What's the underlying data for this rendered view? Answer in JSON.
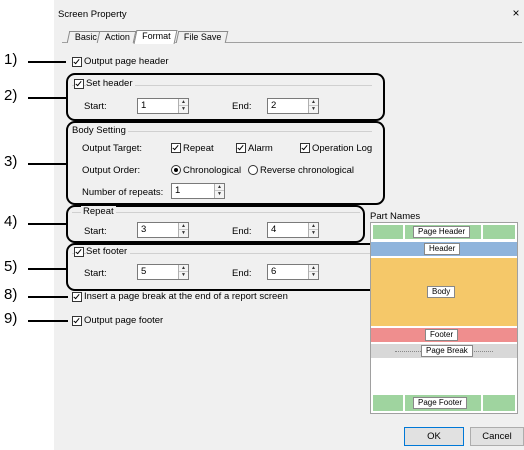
{
  "window": {
    "title": "Screen Property",
    "close_glyph": "×"
  },
  "tabs": [
    {
      "label": "Basic"
    },
    {
      "label": "Action"
    },
    {
      "label": "Format"
    },
    {
      "label": "File Save"
    }
  ],
  "callout_numbers": [
    "1)",
    "2)",
    "3)",
    "4)",
    "5)",
    "8)",
    "9)"
  ],
  "output_page_header": {
    "label": "Output page header",
    "checked": true
  },
  "set_header": {
    "label": "Set header",
    "checked": true,
    "start_label": "Start:",
    "start_value": "1",
    "end_label": "End:",
    "end_value": "2"
  },
  "body_setting": {
    "title": "Body Setting",
    "output_target_label": "Output Target:",
    "targets": [
      {
        "label": "Repeat",
        "checked": true
      },
      {
        "label": "Alarm",
        "checked": true
      },
      {
        "label": "Operation Log",
        "checked": true
      }
    ],
    "output_order_label": "Output Order:",
    "orders": [
      {
        "label": "Chronological",
        "selected": true
      },
      {
        "label": "Reverse chronological",
        "selected": false
      }
    ],
    "repeats_label": "Number of repeats:",
    "repeats_value": "1"
  },
  "repeat": {
    "title": "Repeat",
    "start_label": "Start:",
    "start_value": "3",
    "end_label": "End:",
    "end_value": "4"
  },
  "set_footer": {
    "label": "Set footer",
    "checked": true,
    "start_label": "Start:",
    "start_value": "5",
    "end_label": "End:",
    "end_value": "6"
  },
  "page_break": {
    "label": "Insert a page break at the end of a report screen",
    "checked": true
  },
  "output_page_footer": {
    "label": "Output page footer",
    "checked": true
  },
  "part_names": {
    "title": "Part Names",
    "page_header": "Page Header",
    "header": "Header",
    "body": "Body",
    "footer": "Footer",
    "page_break": "Page Break",
    "page_footer": "Page Footer",
    "colors": {
      "green": "#9fd49f",
      "blue": "#8fb4dc",
      "orange": "#f5c869",
      "red": "#ef8e8e",
      "gray": "#d8d8d8"
    }
  },
  "buttons": {
    "ok": "OK",
    "cancel": "Cancel"
  }
}
